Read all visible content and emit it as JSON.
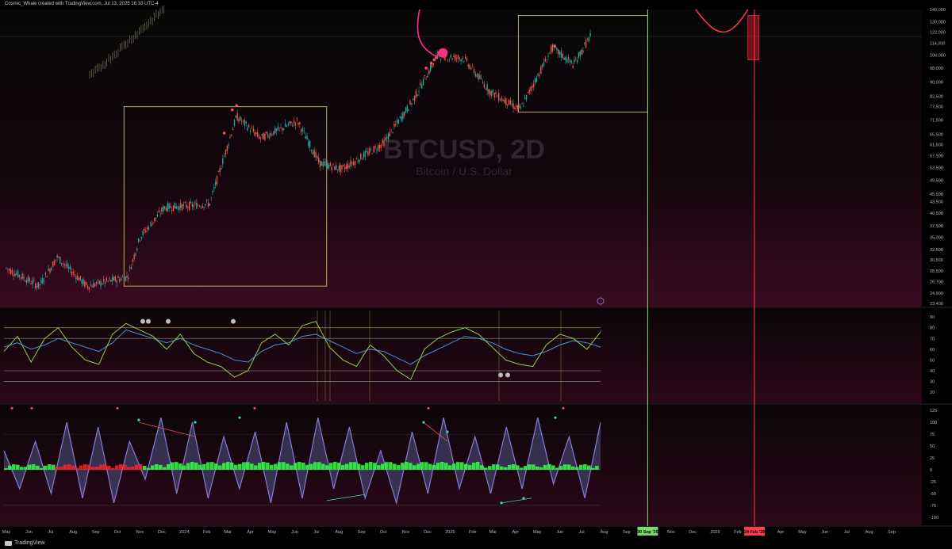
{
  "header": {
    "credit": "Cosmic_Whale created with TradingView.com, Jul 13, 2025 16:33 UTC-4"
  },
  "footer": {
    "brand": "TradingView"
  },
  "watermark": {
    "symbol": "BTCUSD, 2D",
    "name": "Bitcoin / U.S. Dollar"
  },
  "colors": {
    "up": "#26a69a",
    "down": "#ef5350",
    "box": "#b5b04a",
    "green_line": "#7bd96b",
    "red_line": "#ff3b4e",
    "hot_pink": "#ff2d87",
    "rsi_blue": "#4d8fdc",
    "rsi_green": "#8fd14f",
    "osc_purple": "#8a7ad8",
    "flow_green": "#33ff44",
    "flow_red": "#ff2222"
  },
  "chart_data": [
    {
      "type": "candlestick",
      "title": "BTCUSD, 2D",
      "subtitle": "Bitcoin / U.S. Dollar",
      "y_scale": "log",
      "y_ticks": [
        "140,000",
        "130,000",
        "122,000",
        "114,000",
        "106,000",
        "98,000",
        "90,000",
        "82,500",
        "77,500",
        "71,500",
        "65,500",
        "61,500",
        "57,500",
        "53,500",
        "49,500",
        "45,500",
        "43,500",
        "40,500",
        "37,500",
        "35,000",
        "32,500",
        "30,500",
        "28,500",
        "26,700",
        "24,900",
        "23,400"
      ],
      "x_ticks": [
        "May",
        "Jun",
        "Jul",
        "Aug",
        "Sep",
        "Oct",
        "Nov",
        "Dec",
        "2024",
        "Feb",
        "Mar",
        "Apr",
        "May",
        "Jun",
        "Jul",
        "Aug",
        "Sep",
        "Oct",
        "Nov",
        "Dec",
        "2025",
        "Feb",
        "Mar",
        "Apr",
        "May",
        "Jun",
        "Jul",
        "Aug",
        "Sep",
        "30 Sep '25",
        "Nov",
        "Dec",
        "2026",
        "Feb",
        "24 Feb '26",
        "Apr",
        "May",
        "Jun",
        "Jul",
        "Aug",
        "Sep"
      ],
      "price_path": [
        [
          "2023-05-01",
          29000
        ],
        [
          "2023-06-15",
          26000
        ],
        [
          "2023-07-10",
          31000
        ],
        [
          "2023-08-20",
          26000
        ],
        [
          "2023-10-15",
          27500
        ],
        [
          "2023-11-01",
          35000
        ],
        [
          "2023-12-05",
          42000
        ],
        [
          "2024-01-15",
          42500
        ],
        [
          "2024-02-05",
          43000
        ],
        [
          "2024-03-13",
          73000
        ],
        [
          "2024-04-15",
          64000
        ],
        [
          "2024-06-05",
          71000
        ],
        [
          "2024-07-05",
          55000
        ],
        [
          "2024-08-05",
          53000
        ],
        [
          "2024-10-01",
          62000
        ],
        [
          "2024-11-10",
          80000
        ],
        [
          "2024-12-15",
          106000
        ],
        [
          "2025-01-20",
          104000
        ],
        [
          "2025-02-25",
          85000
        ],
        [
          "2025-04-07",
          76000
        ],
        [
          "2025-05-22",
          111000
        ],
        [
          "2025-06-20",
          100000
        ],
        [
          "2025-07-13",
          119000
        ]
      ],
      "boxes": [
        {
          "start": "2023-10-10",
          "end": "2024-07-15",
          "low": 26000,
          "high": 77500
        },
        {
          "start": "2025-04-05",
          "end": "2025-09-30",
          "low": 75000,
          "high": 135000
        }
      ],
      "vertical_markers": [
        {
          "date": "2025-09-30",
          "label": "30 Sep '25",
          "color": "#7bd96b"
        },
        {
          "date": "2026-02-24",
          "label": "24 Feb '26",
          "color": "#ff3b4e"
        }
      ],
      "forecast_band": {
        "start": "2026-02-15",
        "end": "2026-03-02",
        "low": 103000,
        "high": 135000
      }
    },
    {
      "type": "line",
      "title": "",
      "y_ticks": [
        "90",
        "80",
        "70",
        "60",
        "50",
        "40",
        "30",
        "20"
      ],
      "levels": [
        80,
        70,
        40,
        30
      ],
      "series": [
        {
          "color": "#4d8fdc",
          "values": [
            62,
            66,
            60,
            64,
            70,
            66,
            62,
            58,
            66,
            78,
            74,
            70,
            66,
            70,
            64,
            60,
            56,
            50,
            48,
            58,
            64,
            66,
            72,
            74,
            68,
            62,
            56,
            60,
            58,
            52,
            46,
            54,
            60,
            66,
            72,
            70,
            66,
            60,
            56,
            54,
            58,
            64,
            68,
            66,
            62
          ]
        },
        {
          "color": "#8fd14f",
          "values": [
            58,
            72,
            48,
            70,
            80,
            62,
            50,
            46,
            74,
            84,
            78,
            72,
            60,
            74,
            56,
            48,
            44,
            34,
            40,
            66,
            74,
            64,
            82,
            86,
            62,
            50,
            44,
            64,
            54,
            40,
            32,
            60,
            70,
            76,
            80,
            74,
            62,
            50,
            46,
            44,
            64,
            74,
            70,
            60,
            76
          ]
        }
      ]
    },
    {
      "type": "area",
      "title": "",
      "y_ticks": [
        "125",
        "100",
        "75",
        "50",
        "25",
        "0",
        "-25",
        "-50",
        "-75",
        "-100"
      ],
      "series": [
        {
          "color": "#8a7ad8",
          "values": [
            40,
            -40,
            60,
            -50,
            100,
            -60,
            90,
            -70,
            60,
            -20,
            110,
            -50,
            100,
            -60,
            70,
            -40,
            80,
            -70,
            100,
            -60,
            110,
            -40,
            90,
            -60,
            40,
            -70,
            80,
            -50,
            110,
            -40,
            70,
            -50,
            90,
            -40,
            110,
            -30,
            70,
            -60,
            100
          ]
        }
      ]
    }
  ]
}
